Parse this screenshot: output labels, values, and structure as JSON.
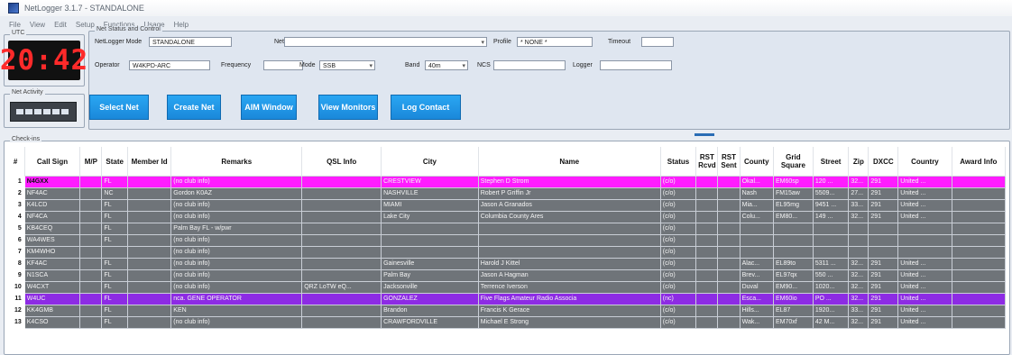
{
  "window": {
    "title": "NetLogger 3.1.7 - STANDALONE"
  },
  "menu": [
    "File",
    "View",
    "Edit",
    "Setup",
    "Functions",
    "Usage",
    "Help"
  ],
  "utc": {
    "label": "UTC",
    "time": "20:42"
  },
  "net_activity": {
    "label": "Net Activity"
  },
  "net_status": {
    "label": "Net Status and Control",
    "mode_label": "NetLogger Mode",
    "mode_value": "STANDALONE",
    "net_label": "Net",
    "net_value": "",
    "profile_label": "Profile",
    "profile_value": "* NONE *",
    "timeout_label": "Timeout",
    "timeout_value": "",
    "operator_label": "Operator",
    "operator_value": "W4KPD-ARC",
    "frequency_label": "Frequency",
    "frequency_value": "",
    "mode2_label": "Mode",
    "mode2_value": "SSB",
    "band_label": "Band",
    "band_value": "40m",
    "ncs_label": "NCS",
    "ncs_value": "",
    "logger_label": "Logger",
    "logger_value": ""
  },
  "buttons": {
    "select_net": "Select Net",
    "create_net": "Create Net",
    "aim_window": "AIM Window",
    "view_monitors": "View Monitors",
    "log_contact": "Log Contact"
  },
  "checkins": {
    "label": "Check-ins",
    "columns": [
      "#",
      "Call Sign",
      "M/P",
      "State",
      "Member Id",
      "Remarks",
      "QSL Info",
      "City",
      "Name",
      "Status",
      "RST Rcvd",
      "RST Sent",
      "County",
      "Grid Square",
      "Street",
      "Zip",
      "DXCC",
      "Country",
      "Award Info"
    ],
    "rows": [
      {
        "n": "1",
        "call": "N4GXX",
        "mp": "",
        "state": "FL",
        "member": "",
        "remarks": "(no club info)",
        "qsl": "",
        "city": "CRESTVIEW",
        "name": "Stephen D Strom",
        "status": "(c/o)",
        "rstr": "",
        "rsts": "",
        "county": "Okal...",
        "grid": "EM60sp",
        "street": "120 ...",
        "zip": "32...",
        "dxcc": "291",
        "country": "United ...",
        "award": "",
        "style": "magenta"
      },
      {
        "n": "2",
        "call": "NF4AC",
        "mp": "",
        "state": "NC",
        "member": "",
        "remarks": "Gordon K0AZ",
        "qsl": "",
        "city": "NASHVILLE",
        "name": "Robert P Griffin Jr",
        "status": "(c/o)",
        "rstr": "",
        "rsts": "",
        "county": "Nash",
        "grid": "FM15aw",
        "street": "5509...",
        "zip": "27...",
        "dxcc": "291",
        "country": "United ...",
        "award": "",
        "style": "gray"
      },
      {
        "n": "3",
        "call": "K4LCD",
        "mp": "",
        "state": "FL",
        "member": "",
        "remarks": "(no club info)",
        "qsl": "",
        "city": "MIAMI",
        "name": "Jason A Granados",
        "status": "(c/o)",
        "rstr": "",
        "rsts": "",
        "county": "Mia...",
        "grid": "EL95mg",
        "street": "9451 ...",
        "zip": "33...",
        "dxcc": "291",
        "country": "United ...",
        "award": "",
        "style": "gray"
      },
      {
        "n": "4",
        "call": "NF4CA",
        "mp": "",
        "state": "FL",
        "member": "",
        "remarks": "(no club info)",
        "qsl": "",
        "city": "Lake City",
        "name": "Columbia County Ares",
        "status": "(c/o)",
        "rstr": "",
        "rsts": "",
        "county": "Colu...",
        "grid": "EM80...",
        "street": "149 ...",
        "zip": "32...",
        "dxcc": "291",
        "country": "United ...",
        "award": "",
        "style": "gray"
      },
      {
        "n": "5",
        "call": "KB4CEQ",
        "mp": "",
        "state": "FL",
        "member": "",
        "remarks": "Palm Bay FL - w/pwr",
        "qsl": "",
        "city": "",
        "name": "",
        "status": "(c/o)",
        "rstr": "",
        "rsts": "",
        "county": "",
        "grid": "",
        "street": "",
        "zip": "",
        "dxcc": "",
        "country": "",
        "award": "",
        "style": "gray"
      },
      {
        "n": "6",
        "call": "WA4WES",
        "mp": "",
        "state": "FL",
        "member": "",
        "remarks": "(no club info)",
        "qsl": "",
        "city": "",
        "name": "",
        "status": "(c/o)",
        "rstr": "",
        "rsts": "",
        "county": "",
        "grid": "",
        "street": "",
        "zip": "",
        "dxcc": "",
        "country": "",
        "award": "",
        "style": "gray"
      },
      {
        "n": "7",
        "call": "KM4WHO",
        "mp": "",
        "state": "",
        "member": "",
        "remarks": "(no club info)",
        "qsl": "",
        "city": "",
        "name": "",
        "status": "(c/o)",
        "rstr": "",
        "rsts": "",
        "county": "",
        "grid": "",
        "street": "",
        "zip": "",
        "dxcc": "",
        "country": "",
        "award": "",
        "style": "gray"
      },
      {
        "n": "8",
        "call": "KF4AC",
        "mp": "",
        "state": "FL",
        "member": "",
        "remarks": "(no club info)",
        "qsl": "",
        "city": "Gainesville",
        "name": "Harold J Kittel",
        "status": "(c/o)",
        "rstr": "",
        "rsts": "",
        "county": "Alac...",
        "grid": "EL89to",
        "street": "5311 ...",
        "zip": "32...",
        "dxcc": "291",
        "country": "United ...",
        "award": "",
        "style": "gray"
      },
      {
        "n": "9",
        "call": "N1SCA",
        "mp": "",
        "state": "FL",
        "member": "",
        "remarks": "(no club info)",
        "qsl": "",
        "city": "Palm Bay",
        "name": "Jason A Hagman",
        "status": "(c/o)",
        "rstr": "",
        "rsts": "",
        "county": "Brev...",
        "grid": "EL97qx",
        "street": "550 ...",
        "zip": "32...",
        "dxcc": "291",
        "country": "United ...",
        "award": "",
        "style": "gray"
      },
      {
        "n": "10",
        "call": "W4CXT",
        "mp": "",
        "state": "FL",
        "member": "",
        "remarks": "(no club info)",
        "qsl": "QRZ LoTW eQ...",
        "city": "Jacksonville",
        "name": "Terrence Iverson",
        "status": "(c/o)",
        "rstr": "",
        "rsts": "",
        "county": "Duval",
        "grid": "EM90...",
        "street": "1020...",
        "zip": "32...",
        "dxcc": "291",
        "country": "United ...",
        "award": "",
        "style": "gray"
      },
      {
        "n": "11",
        "call": "W4UC",
        "mp": "",
        "state": "FL",
        "member": "",
        "remarks": "nca. GENE OPERATOR",
        "qsl": "",
        "city": "GONZALEZ",
        "name": "Five Flags Amateur Radio Associa",
        "status": "(nc)",
        "rstr": "",
        "rsts": "",
        "county": "Esca...",
        "grid": "EM60io",
        "street": "PO ...",
        "zip": "32...",
        "dxcc": "291",
        "country": "United ...",
        "award": "",
        "style": "purple"
      },
      {
        "n": "12",
        "call": "KK4GMB",
        "mp": "",
        "state": "FL",
        "member": "",
        "remarks": "KEN",
        "qsl": "",
        "city": "Brandon",
        "name": "Francis K Gerace",
        "status": "(c/o)",
        "rstr": "",
        "rsts": "",
        "county": "Hills...",
        "grid": "EL87",
        "street": "1920...",
        "zip": "33...",
        "dxcc": "291",
        "country": "United ...",
        "award": "",
        "style": "gray"
      },
      {
        "n": "13",
        "call": "K4CSO",
        "mp": "",
        "state": "FL",
        "member": "",
        "remarks": "(no club info)",
        "qsl": "",
        "city": "CRAWFORDVILLE",
        "name": "Michael E Strong",
        "status": "(c/o)",
        "rstr": "",
        "rsts": "",
        "county": "Wak...",
        "grid": "EM70xf",
        "street": "42 M...",
        "zip": "32...",
        "dxcc": "291",
        "country": "United ...",
        "award": "",
        "style": "gray"
      }
    ]
  }
}
